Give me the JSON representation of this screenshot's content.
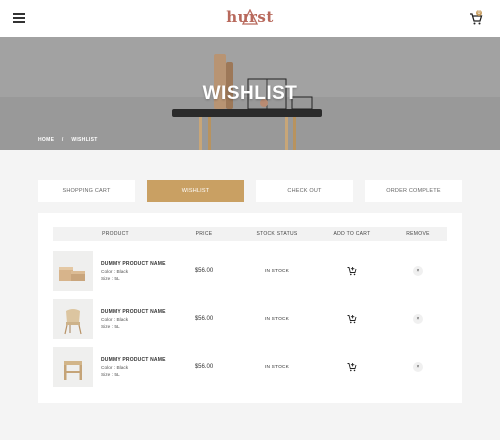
{
  "header": {
    "logo_text": "hurst",
    "cart_count": "0"
  },
  "banner": {
    "title": "WISHLIST",
    "breadcrumb": [
      "HOME",
      "/",
      "WISHLIST"
    ]
  },
  "steps": [
    {
      "label": "SHOPPING CART",
      "active": false
    },
    {
      "label": "WISHLIST",
      "active": true
    },
    {
      "label": "CHECK OUT",
      "active": false
    },
    {
      "label": "ORDER COMPLETE",
      "active": false
    }
  ],
  "table": {
    "headers": [
      "PRODUCT",
      "PRICE",
      "STOCK STATUS",
      "ADD TO CART",
      "REMOVE"
    ],
    "rows": [
      {
        "name": "DUMMY PRODUCT NAME",
        "color": "Color : Black",
        "size": "Size : 5L",
        "price": "$56.00",
        "stock": "IN STOCK",
        "remove": "×"
      },
      {
        "name": "DUMMY PRODUCT NAME",
        "color": "Color : Black",
        "size": "Size : 5L",
        "price": "$56.00",
        "stock": "IN STOCK",
        "remove": "×"
      },
      {
        "name": "DUMMY PRODUCT NAME",
        "color": "Color : Black",
        "size": "Size : 5L",
        "price": "$56.00",
        "stock": "IN STOCK",
        "remove": "×"
      }
    ]
  },
  "colors": {
    "accent": "#c9a063",
    "logo": "#b8695c"
  },
  "icons": {
    "menu": "hamburger-icon",
    "cart": "cart-icon",
    "add_to_cart": "cart-plus-icon",
    "remove": "close-icon"
  }
}
